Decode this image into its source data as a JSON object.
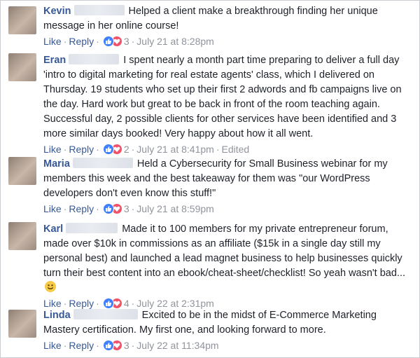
{
  "comments": [
    {
      "author": "Kevin",
      "text": "Helped a client make a breakthrough finding her unique message in her online course!",
      "like": "Like",
      "reply": "Reply",
      "count": "3",
      "date": "July 21 at 8:28pm"
    },
    {
      "author": "Eran",
      "text": "I spent nearly a month part time preparing to deliver a full day 'intro to digital marketing for real estate agents' class, which I delivered on Thursday. 19 students who set up their first 2 adwords and fb campaigns live on the day. Hard work but great to be back in front of the room teaching again. Successful day, 2 possible clients for other services have been identified and 3 more similar days booked! Very happy about how it all went.",
      "like": "Like",
      "reply": "Reply",
      "count": "2",
      "date": "July 21 at 8:41pm",
      "edited": "Edited"
    },
    {
      "author": "Maria",
      "text": "Held a Cybersecurity for Small Business webinar for my members this week and the best takeaway for them was \"our WordPress developers don't even know this stuff!\"",
      "like": "Like",
      "reply": "Reply",
      "count": "3",
      "date": "July 21 at 8:59pm"
    },
    {
      "author": "Karl",
      "text": "Made it to 100 members for my private entrepreneur forum, made over $10k in commissions as an affiliate ($15k in a single day still my personal best) and launched a lead magnet business to help businesses quickly turn their best content into an ebook/cheat-sheet/checklist! So yeah wasn't bad...",
      "like": "Like",
      "reply": "Reply",
      "count": "4",
      "date": "July 22 at 2:31pm"
    },
    {
      "author": "Linda",
      "text": "Excited to be in the midst of E-Commerce Marketing Mastery certification. My first one, and looking forward to more.",
      "like": "Like",
      "reply": "Reply",
      "count": "3",
      "date": "July 22 at 11:34pm"
    }
  ],
  "colors": {
    "author": "#365899",
    "text": "#1d2129",
    "meta": "#90949c",
    "like_reaction": "#4080ff",
    "love_reaction": "#f25268"
  },
  "icons": {
    "reaction_like": "thumbs-up-icon",
    "reaction_love": "heart-icon",
    "smiley": "smiley-emoji-icon"
  }
}
